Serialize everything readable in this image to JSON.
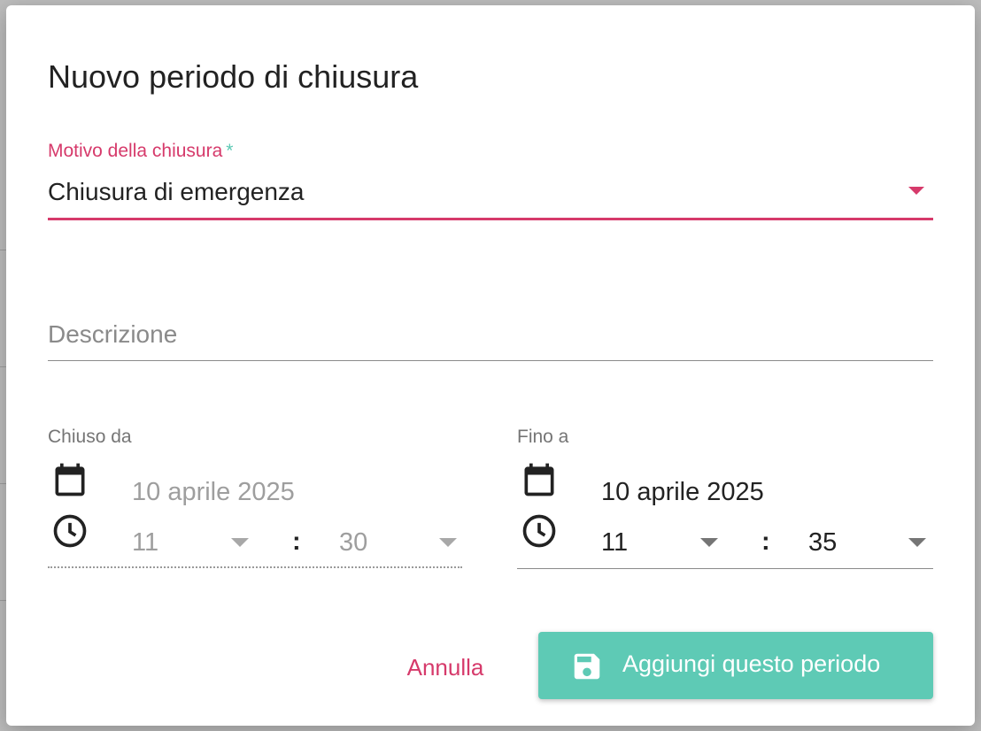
{
  "dialog": {
    "title": "Nuovo periodo di chiusura",
    "reason": {
      "label": "Motivo della chiusura",
      "required_mark": "*",
      "value": "Chiusura di emergenza"
    },
    "description": {
      "placeholder": "Descrizione"
    },
    "from": {
      "label": "Chiuso da",
      "date": "10 aprile 2025",
      "hour": "11",
      "minute": "30"
    },
    "to": {
      "label": "Fino a",
      "date": "10 aprile 2025",
      "hour": "11",
      "minute": "35"
    },
    "time_separator": ":",
    "cancel_label": "Annulla",
    "save_label": "Aggiungi questo periodo",
    "icons": {
      "calendar": "calendar-icon",
      "clock": "clock-icon",
      "save": "floppy-disk-icon",
      "dropdown": "caret-down-icon"
    },
    "colors": {
      "accent": "#d63a6b",
      "primary": "#5ecab5"
    }
  }
}
